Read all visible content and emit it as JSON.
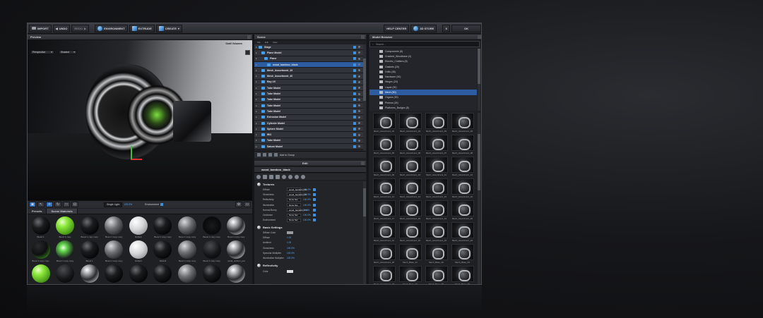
{
  "colors": {
    "accent": "#2d5da0",
    "brand_blue": "#3a85d6",
    "green": "#7ae03c"
  },
  "toolbar": {
    "import": "IMPORT",
    "undo": "UNDO",
    "redo": "REDO",
    "environment": "ENVIRONMENT",
    "extrude": "EXTRUDE",
    "create": "CREATE",
    "help_center": "HELP CENTER",
    "store": "3D STORE",
    "close": "X",
    "ok": "OK"
  },
  "preview": {
    "title": "Preview",
    "draft_label": "Draft Volumes",
    "camera_select": "Perspective",
    "shading_select": "Shaded",
    "light_label": "Single Light",
    "light_value": "125.0%",
    "environment_label": "Environment"
  },
  "presets": {
    "tabs": [
      "Presets",
      "Scene Materials"
    ],
    "swatches": [
      {
        "label": "Bevel 1",
        "kind": "black"
      },
      {
        "label": "Bevel 1 copy",
        "kind": "green"
      },
      {
        "label": "Bevel 1 copy copy",
        "kind": "black"
      },
      {
        "label": "Bevel 1 copy copy",
        "kind": "gray"
      },
      {
        "label": "Default",
        "kind": "white"
      },
      {
        "label": "Bevel 1 copy copy",
        "kind": "black"
      },
      {
        "label": "Bevel 1 copy copy",
        "kind": "gray"
      },
      {
        "label": "Bevel 1 copy copy",
        "kind": "green-dark"
      },
      {
        "label": "Bevel 1 copy copy",
        "kind": "chrome"
      },
      {
        "label": "Bevel 1 copy copy",
        "kind": "black-green"
      },
      {
        "label": "Bevel 1 copy copy",
        "kind": "green-light"
      },
      {
        "label": "Bevel 1",
        "kind": "black"
      },
      {
        "label": "Bevel 1 copy copy",
        "kind": "gray"
      },
      {
        "label": "Default",
        "kind": "white"
      },
      {
        "label": "Default",
        "kind": "black"
      },
      {
        "label": "Bevel 1 copy copy",
        "kind": "gray"
      },
      {
        "label": "Bevel 1 copy copy",
        "kind": "dark"
      },
      {
        "label": "metal_uniform_pat",
        "kind": "chrome"
      },
      {
        "label": "",
        "kind": "green"
      },
      {
        "label": "",
        "kind": "dark"
      },
      {
        "label": "",
        "kind": "chrome"
      },
      {
        "label": "",
        "kind": "black"
      },
      {
        "label": "",
        "kind": "black"
      },
      {
        "label": "",
        "kind": "black"
      },
      {
        "label": "",
        "kind": "gray"
      },
      {
        "label": "",
        "kind": "black"
      },
      {
        "label": "",
        "kind": "chrome"
      }
    ]
  },
  "scene": {
    "title": "Scene",
    "menu": [
      "File",
      "Edit",
      "View"
    ],
    "rows": [
      {
        "name": "Stage",
        "depth": 0,
        "selected": false
      },
      {
        "name": "Plane Model",
        "depth": 1,
        "selected": false
      },
      {
        "name": "Plane",
        "depth": 2,
        "selected": false
      },
      {
        "name": "wood_bamboo_black",
        "depth": 3,
        "selected": true
      },
      {
        "name": "Mesh_Assortment_39",
        "depth": 1,
        "selected": false
      },
      {
        "name": "Mesh_Assortment_40",
        "depth": 1,
        "selected": false
      },
      {
        "name": "Ray UV",
        "depth": 1,
        "selected": false
      },
      {
        "name": "Tube Model",
        "depth": 1,
        "selected": false
      },
      {
        "name": "Tube Model",
        "depth": 1,
        "selected": false
      },
      {
        "name": "Tube Model",
        "depth": 1,
        "selected": false
      },
      {
        "name": "Tube Model",
        "depth": 1,
        "selected": false
      },
      {
        "name": "Tube Model",
        "depth": 1,
        "selected": false
      },
      {
        "name": "Extrusion Model",
        "depth": 1,
        "selected": false
      },
      {
        "name": "Cylinder Model",
        "depth": 1,
        "selected": false
      },
      {
        "name": "Sphere Model",
        "depth": 1,
        "selected": false
      },
      {
        "name": "IBO",
        "depth": 1,
        "selected": false
      },
      {
        "name": "Tube Model",
        "depth": 1,
        "selected": false
      },
      {
        "name": "Saturn Model",
        "depth": 1,
        "selected": false
      }
    ],
    "footer_label": "Add to Group"
  },
  "edit": {
    "title": "Edit",
    "material_name": "wood_bamboo_black",
    "textures_label": "Textures",
    "textures": [
      {
        "label": "Diffuse",
        "value": "wood_bamboo_bla",
        "num": "100.0%"
      },
      {
        "label": "Glossiness",
        "value": "wood_bamboo_ref",
        "num": "100.0%"
      },
      {
        "label": "Reflectivity",
        "value": "None Set",
        "num": "100.0%"
      },
      {
        "label": "Illumination",
        "value": "None Set",
        "num": "100.0%"
      },
      {
        "label": "Normal Bump",
        "value": "wood_bamboo_nrm",
        "num": "30.0%"
      },
      {
        "label": "Occlusion",
        "value": "None Set",
        "num": "100.0%"
      },
      {
        "label": "Environment",
        "value": "None Set",
        "num": "100.0%"
      }
    ],
    "basic_label": "Basic Settings",
    "basic": [
      {
        "label": "Diffuse Color",
        "num": ""
      },
      {
        "label": "Diffuse",
        "num": "1.00"
      },
      {
        "label": "Ambient",
        "num": "1.00"
      },
      {
        "label": "Glossiness",
        "num": "100.0%"
      },
      {
        "label": "Specular Multiplier",
        "num": "100.0%"
      },
      {
        "label": "Illumination Multiplier",
        "num": "100.0%"
      }
    ],
    "reflectivity_label": "Reflectivity",
    "color_label": "Color"
  },
  "browser": {
    "title": "Model Browser",
    "search_placeholder": "Search...",
    "tree": [
      {
        "label": "Components (6)",
        "selected": false
      },
      {
        "label": "Cracked_Woodbase (4)",
        "selected": false
      },
      {
        "label": "Electric_Cluttters (8)",
        "selected": false
      },
      {
        "label": "Gaskets (20)",
        "selected": false
      },
      {
        "label": "Grills (36)",
        "selected": false
      },
      {
        "label": "Hardware (30)",
        "selected": false
      },
      {
        "label": "Hinges (20)",
        "selected": false
      },
      {
        "label": "Liquid (30)",
        "selected": false
      },
      {
        "label": "Mech (50)",
        "selected": true
      },
      {
        "label": "Organs (30)",
        "selected": false
      },
      {
        "label": "Pistons (26)",
        "selected": false
      },
      {
        "label": "Platforms_Badges (8)",
        "selected": false
      }
    ],
    "thumbs": [
      "Mech_Assortment_01",
      "Mech_Assortment_02",
      "Mech_Assortment_03",
      "Mech_Assortment_04",
      "Mech_Assortment_05",
      "Mech_Assortment_06",
      "Mech_Assortment_07",
      "Mech_Assortment_08",
      "Mech_Assortment_09",
      "Mech_Assortment_10",
      "Mech_Assortment_11",
      "Mech_Assortment_12",
      "Mech_Assortment_13",
      "Mech_Assortment_14",
      "Mech_Assortment_15",
      "Mech_Assortment_16",
      "Mech_Assortment_17",
      "Mech_Assortment_18",
      "Mech_Assortment_19",
      "Mech_Assortment_20",
      "Mech_Assortment_21",
      "Mech_Assortment_22",
      "Mech_Assortment_23",
      "Mech_Assortment_24",
      "Mech_Assortment_25",
      "Mech_Base_01",
      "Mech_Base_02",
      "Mech_Base_03",
      "Mech_Assortment_26",
      "Mech_Base_04",
      "Mech_Base_05",
      "Mech_Base_06",
      "Mech_Base_07",
      "Mech_Cartoon_01",
      "Mech_Cartoon_02",
      "Mech_Dex_01"
    ]
  }
}
